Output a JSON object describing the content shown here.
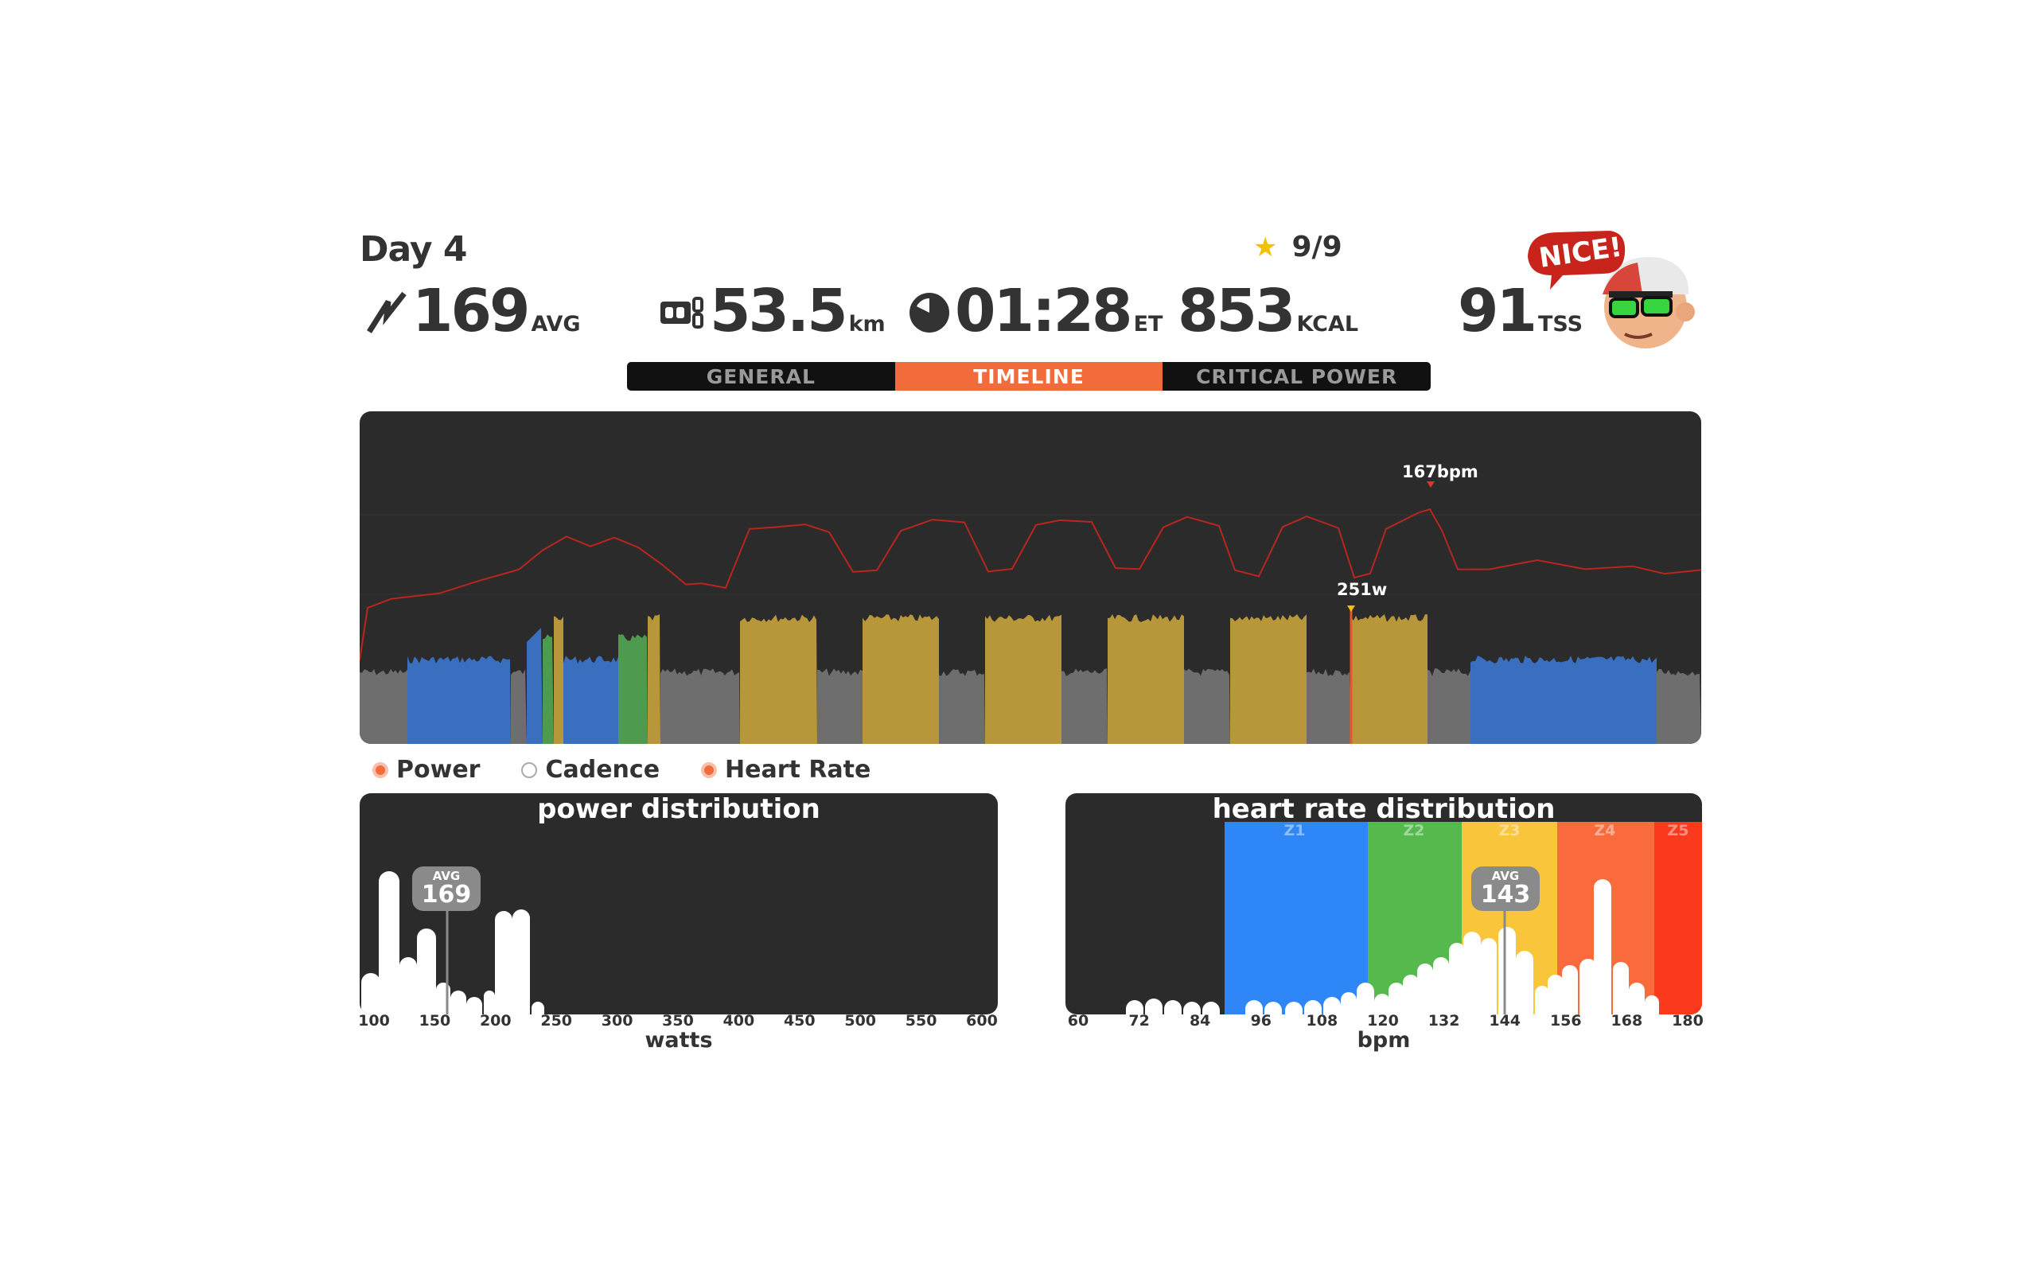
{
  "header": {
    "day": "Day 4",
    "stars": "9/9",
    "badge_text": "NICE!",
    "stats": [
      {
        "value": "169",
        "unit": "AVG",
        "icon": "power-bolt-icon"
      },
      {
        "value": "53.5",
        "unit": "km",
        "icon": "odometer-icon"
      },
      {
        "value": "01:28",
        "unit": "ET",
        "icon": "clock-icon"
      },
      {
        "value": "853",
        "unit": "KCAL"
      },
      {
        "value": "91",
        "unit": "TSS"
      }
    ]
  },
  "tabs": [
    "GENERAL",
    "TIMELINE",
    "CRITICAL POWER"
  ],
  "active_tab": "TIMELINE",
  "timeline": {
    "hr_peak_label": "167bpm",
    "power_peak_label": "251w"
  },
  "legend": [
    "Power",
    "Cadence",
    "Heart Rate"
  ],
  "power_distribution": {
    "title": "power distribution",
    "avg_label": "AVG",
    "avg_value": "169",
    "ticks": [
      "100",
      "150",
      "200",
      "250",
      "300",
      "350",
      "400",
      "450",
      "500",
      "550",
      "600"
    ],
    "xlabel": "watts"
  },
  "hr_distribution": {
    "title": "heart rate distribution",
    "avg_label": "AVG",
    "avg_value": "143",
    "zones": [
      "Z1",
      "Z2",
      "Z3",
      "Z4",
      "Z5"
    ],
    "ticks": [
      "60",
      "72",
      "84",
      "96",
      "108",
      "120",
      "132",
      "144",
      "156",
      "168",
      "180"
    ],
    "xlabel": "bpm"
  },
  "colors": {
    "accent": "#f26b3a",
    "panel": "#2b2b2b",
    "z1": "#2f86f6",
    "z2": "#55b94d",
    "z3": "#f8c53b",
    "z4": "#f96b3c",
    "z5": "#fb3a1d",
    "power_gray": "#6e6e6e",
    "power_blue": "#3a6fc0",
    "power_green": "#4e9a4f",
    "power_yellow": "#b8973a",
    "hr_line": "#b8261e"
  }
}
